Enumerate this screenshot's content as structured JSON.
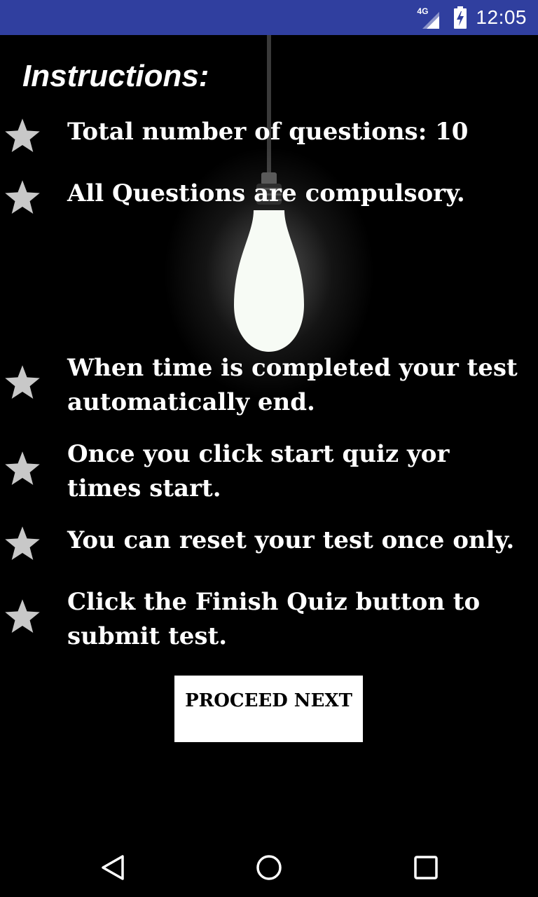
{
  "status_bar": {
    "network_label": "4G",
    "time": "12:05",
    "icons": [
      "signal-4g-icon",
      "battery-charging-icon"
    ]
  },
  "instructions": {
    "title": "Instructions:",
    "items": [
      {
        "text": "Total number of questions: 10",
        "icon": "star-icon"
      },
      {
        "text": "All Questions are compulsory.",
        "icon": "star-icon"
      },
      {
        "text": "When time is completed your test automatically end.",
        "icon": "star-icon"
      },
      {
        "text": "Once you click start quiz yor times start.",
        "icon": "star-icon"
      },
      {
        "text": "You can reset your test once only.",
        "icon": "star-icon"
      },
      {
        "text": "Click the Finish Quiz button to submit test.",
        "icon": "star-icon"
      }
    ]
  },
  "proceed_button": {
    "label": "PROCEED NEXT"
  },
  "navigation": {
    "icons": [
      "back-icon",
      "home-icon",
      "recents-icon"
    ]
  },
  "colors": {
    "status_bar": "#303f9f",
    "background": "#000000",
    "text": "#ffffff",
    "star": "#c8c8c8",
    "button_bg": "#ffffff"
  }
}
